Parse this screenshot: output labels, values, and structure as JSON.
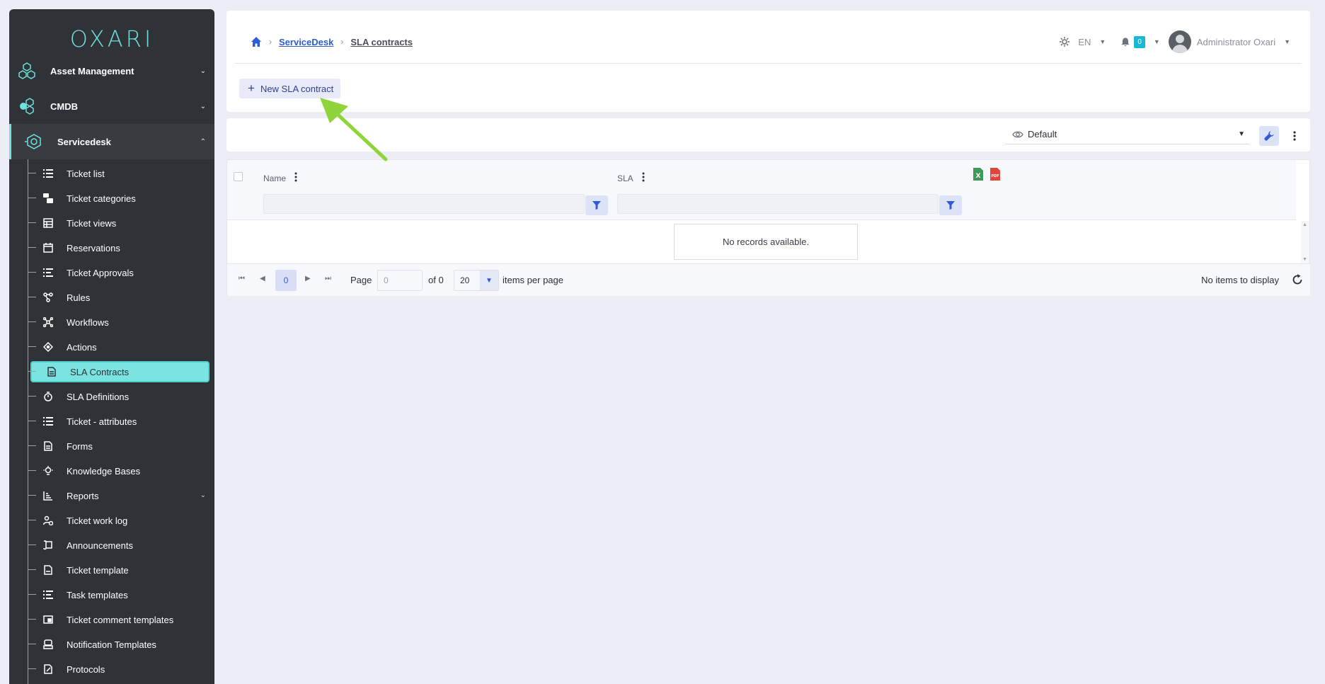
{
  "app": {
    "logo": "OXARI"
  },
  "sidebar": {
    "top_items": [
      {
        "label": "Asset Management",
        "icon": "hexagon-nodes-icon"
      },
      {
        "label": "CMDB",
        "icon": "cmdb-icon"
      },
      {
        "label": "Servicedesk",
        "icon": "servicedesk-icon"
      }
    ],
    "sub_items": [
      {
        "label": "Ticket list",
        "icon": "list-icon"
      },
      {
        "label": "Ticket categories",
        "icon": "categories-icon"
      },
      {
        "label": "Ticket views",
        "icon": "table-icon"
      },
      {
        "label": "Reservations",
        "icon": "calendar-icon"
      },
      {
        "label": "Ticket Approvals",
        "icon": "approval-list-icon"
      },
      {
        "label": "Rules",
        "icon": "rules-icon"
      },
      {
        "label": "Workflows",
        "icon": "workflow-icon"
      },
      {
        "label": "Actions",
        "icon": "actions-icon"
      },
      {
        "label": "SLA Contracts",
        "icon": "document-icon"
      },
      {
        "label": "SLA Definitions",
        "icon": "stopwatch-icon"
      },
      {
        "label": "Ticket - attributes",
        "icon": "attributes-icon"
      },
      {
        "label": "Forms",
        "icon": "form-icon"
      },
      {
        "label": "Knowledge Bases",
        "icon": "lightbulb-icon"
      },
      {
        "label": "Reports",
        "icon": "chart-icon"
      },
      {
        "label": "Ticket work log",
        "icon": "user-clock-icon"
      },
      {
        "label": "Announcements",
        "icon": "scroll-icon"
      },
      {
        "label": "Ticket template",
        "icon": "template-icon"
      },
      {
        "label": "Task templates",
        "icon": "task-list-icon"
      },
      {
        "label": "Ticket comment templates",
        "icon": "comment-template-icon"
      },
      {
        "label": "Notification Templates",
        "icon": "notification-template-icon"
      },
      {
        "label": "Protocols",
        "icon": "protocol-icon"
      }
    ]
  },
  "header": {
    "breadcrumb": [
      "ServiceDesk",
      "SLA contracts"
    ],
    "language": "EN",
    "notifications_count": "0",
    "user_name": "Administrator Oxari",
    "new_button_label": "New SLA contract"
  },
  "toolbar": {
    "view_name": "Default"
  },
  "grid": {
    "columns": [
      "Name",
      "SLA"
    ],
    "empty_message": "No records available."
  },
  "pager": {
    "current_page": "0",
    "page_label": "Page",
    "page_input_placeholder": "0",
    "of_label": "of 0",
    "page_size": "20",
    "items_per_page_label": "items per page",
    "status": "No items to display"
  },
  "colors": {
    "accent": "#6fe0dc",
    "sidebar_bg": "#2f3236",
    "link": "#2e5bd6",
    "annotation_arrow": "#8ed43a"
  }
}
